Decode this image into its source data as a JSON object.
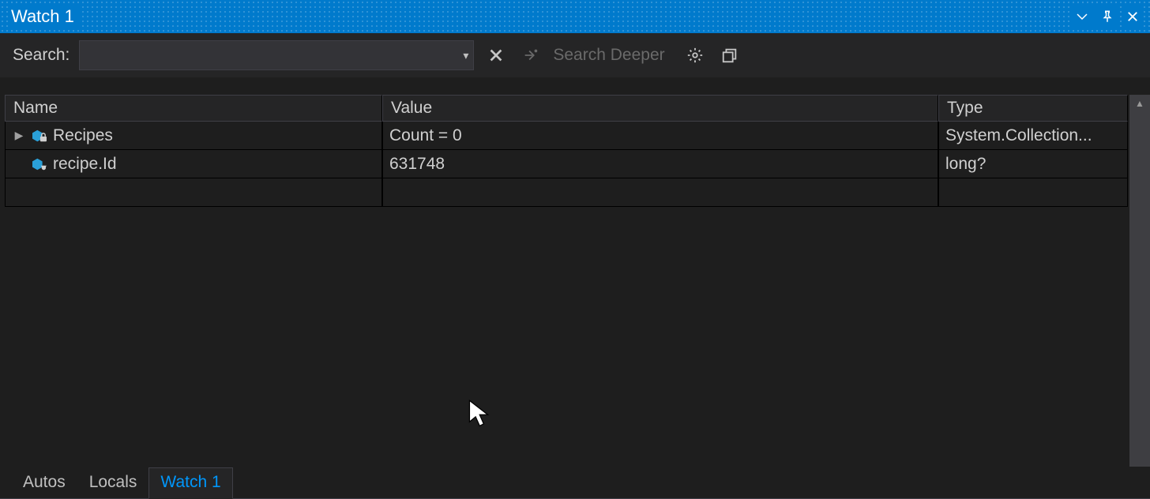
{
  "window": {
    "title": "Watch 1"
  },
  "toolbar": {
    "search_label": "Search:",
    "search_value": "",
    "search_deeper_label": "Search Deeper"
  },
  "grid": {
    "headers": {
      "name": "Name",
      "value": "Value",
      "type": "Type"
    },
    "rows": [
      {
        "expandable": true,
        "icon": "object-lock",
        "name": "Recipes",
        "value": "Count = 0",
        "type": "System.Collection..."
      },
      {
        "expandable": false,
        "icon": "object-prop",
        "name": "recipe.Id",
        "value": "631748",
        "type": "long?"
      }
    ]
  },
  "tabs": {
    "items": [
      {
        "label": "Autos",
        "active": false
      },
      {
        "label": "Locals",
        "active": false
      },
      {
        "label": "Watch 1",
        "active": true
      }
    ]
  }
}
